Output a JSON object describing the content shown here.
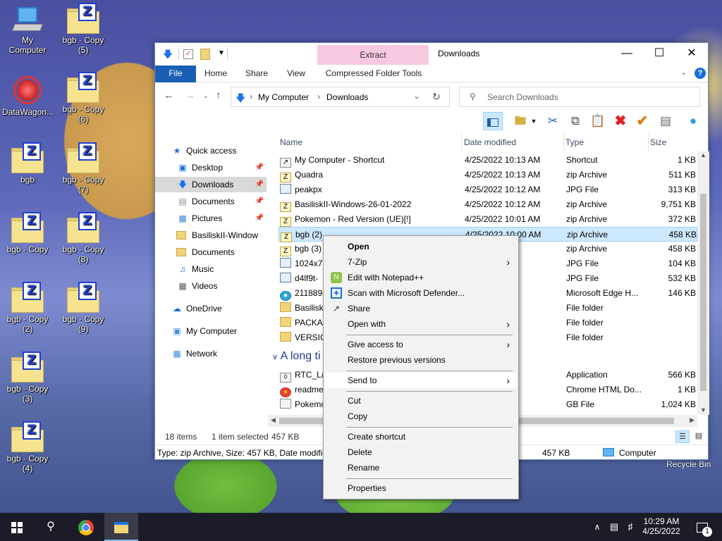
{
  "desktop": {
    "icons": [
      {
        "label": "My Computer",
        "icon": "computer-icon"
      },
      {
        "label": "bgb - Copy (5)",
        "icon": "zip-folder-icon"
      },
      {
        "label": "DataWagon...",
        "icon": "datawagon-icon"
      },
      {
        "label": "bgb - Copy (6)",
        "icon": "zip-folder-icon"
      },
      {
        "label": "bgb",
        "icon": "zip-folder-icon"
      },
      {
        "label": "bgb - Copy (7)",
        "icon": "zip-folder-icon"
      },
      {
        "label": "bgb - Copy",
        "icon": "zip-folder-icon"
      },
      {
        "label": "bgb - Copy (8)",
        "icon": "zip-folder-icon"
      },
      {
        "label": "bgb - Copy (2)",
        "icon": "zip-folder-icon"
      },
      {
        "label": "bgb - Copy (9)",
        "icon": "zip-folder-icon"
      },
      {
        "label": "bgb - Copy (3)",
        "icon": "zip-folder-icon"
      },
      {
        "label": "bgb - Copy (4)",
        "icon": "zip-folder-icon"
      }
    ],
    "recycle_bin": "Recycle Bin"
  },
  "window": {
    "title": "Downloads",
    "context_tab": "Extract",
    "ribbon_tabs": [
      "File",
      "Home",
      "Share",
      "View",
      "Compressed Folder Tools"
    ],
    "breadcrumb": [
      "My Computer",
      "Downloads"
    ],
    "search_placeholder": "Search Downloads",
    "nav": [
      {
        "label": "Quick access",
        "icon": "star-icon"
      },
      {
        "label": "Desktop",
        "icon": "desktop-icon",
        "pinned": true
      },
      {
        "label": "Downloads",
        "icon": "download-arrow-icon",
        "pinned": true,
        "selected": true
      },
      {
        "label": "Documents",
        "icon": "documents-icon",
        "pinned": true
      },
      {
        "label": "Pictures",
        "icon": "pictures-icon",
        "pinned": true
      },
      {
        "label": "BasiliskII-Window",
        "icon": "folder-icon"
      },
      {
        "label": "Documents",
        "icon": "folder-icon"
      },
      {
        "label": "Music",
        "icon": "music-icon"
      },
      {
        "label": "Videos",
        "icon": "videos-icon"
      },
      {
        "label": "OneDrive",
        "icon": "cloud-icon"
      },
      {
        "label": "My Computer",
        "icon": "computer-icon"
      },
      {
        "label": "Network",
        "icon": "network-icon"
      }
    ],
    "columns": [
      "Name",
      "Date modified",
      "Type",
      "Size"
    ],
    "files": [
      {
        "name": "My Computer - Shortcut",
        "date": "4/25/2022 10:13 AM",
        "type": "Shortcut",
        "size": "1 KB",
        "kind": "lnk"
      },
      {
        "name": "Quadra",
        "date": "4/25/2022 10:13 AM",
        "type": "zip Archive",
        "size": "511 KB",
        "kind": "zip"
      },
      {
        "name": "peakpx",
        "date": "4/25/2022 10:12 AM",
        "type": "JPG File",
        "size": "313 KB",
        "kind": "jpg"
      },
      {
        "name": "BasiliskII-Windows-26-01-2022",
        "date": "4/25/2022 10:12 AM",
        "type": "zip Archive",
        "size": "9,751 KB",
        "kind": "zip"
      },
      {
        "name": "Pokemon - Red Version (UE)[!]",
        "date": "4/25/2022 10:01 AM",
        "type": "zip Archive",
        "size": "372 KB",
        "kind": "zip"
      },
      {
        "name": "bgb (2)",
        "date": "4/25/2022 10:00 AM",
        "type": "zip Archive",
        "size": "458 KB",
        "kind": "zip",
        "selected": true
      },
      {
        "name": "bgb (3)",
        "date": "AM",
        "type": "zip Archive",
        "size": "458 KB",
        "kind": "zip"
      },
      {
        "name": "1024x76",
        "date": "AM",
        "type": "JPG File",
        "size": "104 KB",
        "kind": "jpg"
      },
      {
        "name": "d4lf9t-",
        "date": "AM",
        "type": "JPG File",
        "size": "532 KB",
        "kind": "jpg"
      },
      {
        "name": "2118898",
        "date": "AM",
        "type": "Microsoft Edge H...",
        "size": "146 KB",
        "kind": "edge"
      },
      {
        "name": "BasiliskI",
        "date": "7 AM",
        "type": "File folder",
        "size": "",
        "kind": "fold"
      },
      {
        "name": "PACKAG",
        "date": "4 AM",
        "type": "File folder",
        "size": "",
        "kind": "fold"
      },
      {
        "name": "VERSIO",
        "date": "4 AM",
        "type": "File folder",
        "size": "",
        "kind": "fold"
      }
    ],
    "group_label": "A long ti",
    "older_files": [
      {
        "name": "RTC_Lau",
        "date": "PM",
        "type": "Application",
        "size": "566 KB",
        "kind": "app"
      },
      {
        "name": "readme",
        "date": "PM",
        "type": "Chrome HTML Do...",
        "size": "1 KB",
        "kind": "chrome"
      },
      {
        "name": "Pokemo",
        "date": "0 PM",
        "type": "GB File",
        "size": "1,024 KB",
        "kind": "gb"
      }
    ],
    "status": {
      "items": "18 items",
      "selected": "1 item selected",
      "size": "457 KB"
    },
    "details_bar": {
      "text": "Type: zip Archive, Size: 457 KB, Date modified",
      "size": "457 KB",
      "location": "Computer"
    }
  },
  "context_menu": {
    "items": [
      {
        "label": "Open",
        "bold": true
      },
      {
        "label": "7-Zip",
        "submenu": true
      },
      {
        "label": "Edit with Notepad++",
        "icon": "notepadpp-icon"
      },
      {
        "label": "Scan with Microsoft Defender...",
        "icon": "defender-icon"
      },
      {
        "label": "Share",
        "icon": "share-icon"
      },
      {
        "label": "Open with",
        "submenu": true
      },
      {
        "label": "Give access to",
        "submenu": true
      },
      {
        "label": "Restore previous versions"
      },
      {
        "label": "Send to",
        "submenu": true,
        "hover": true
      },
      {
        "label": "Cut"
      },
      {
        "label": "Copy"
      },
      {
        "label": "Create shortcut"
      },
      {
        "label": "Delete"
      },
      {
        "label": "Rename"
      },
      {
        "label": "Properties"
      }
    ]
  },
  "taskbar": {
    "time": "10:29 AM",
    "date": "4/25/2022",
    "notification_count": "1"
  },
  "colors": {
    "accent": "#1a5fb4",
    "selection": "#cce8ff",
    "taskbar": "#1c1c28"
  }
}
